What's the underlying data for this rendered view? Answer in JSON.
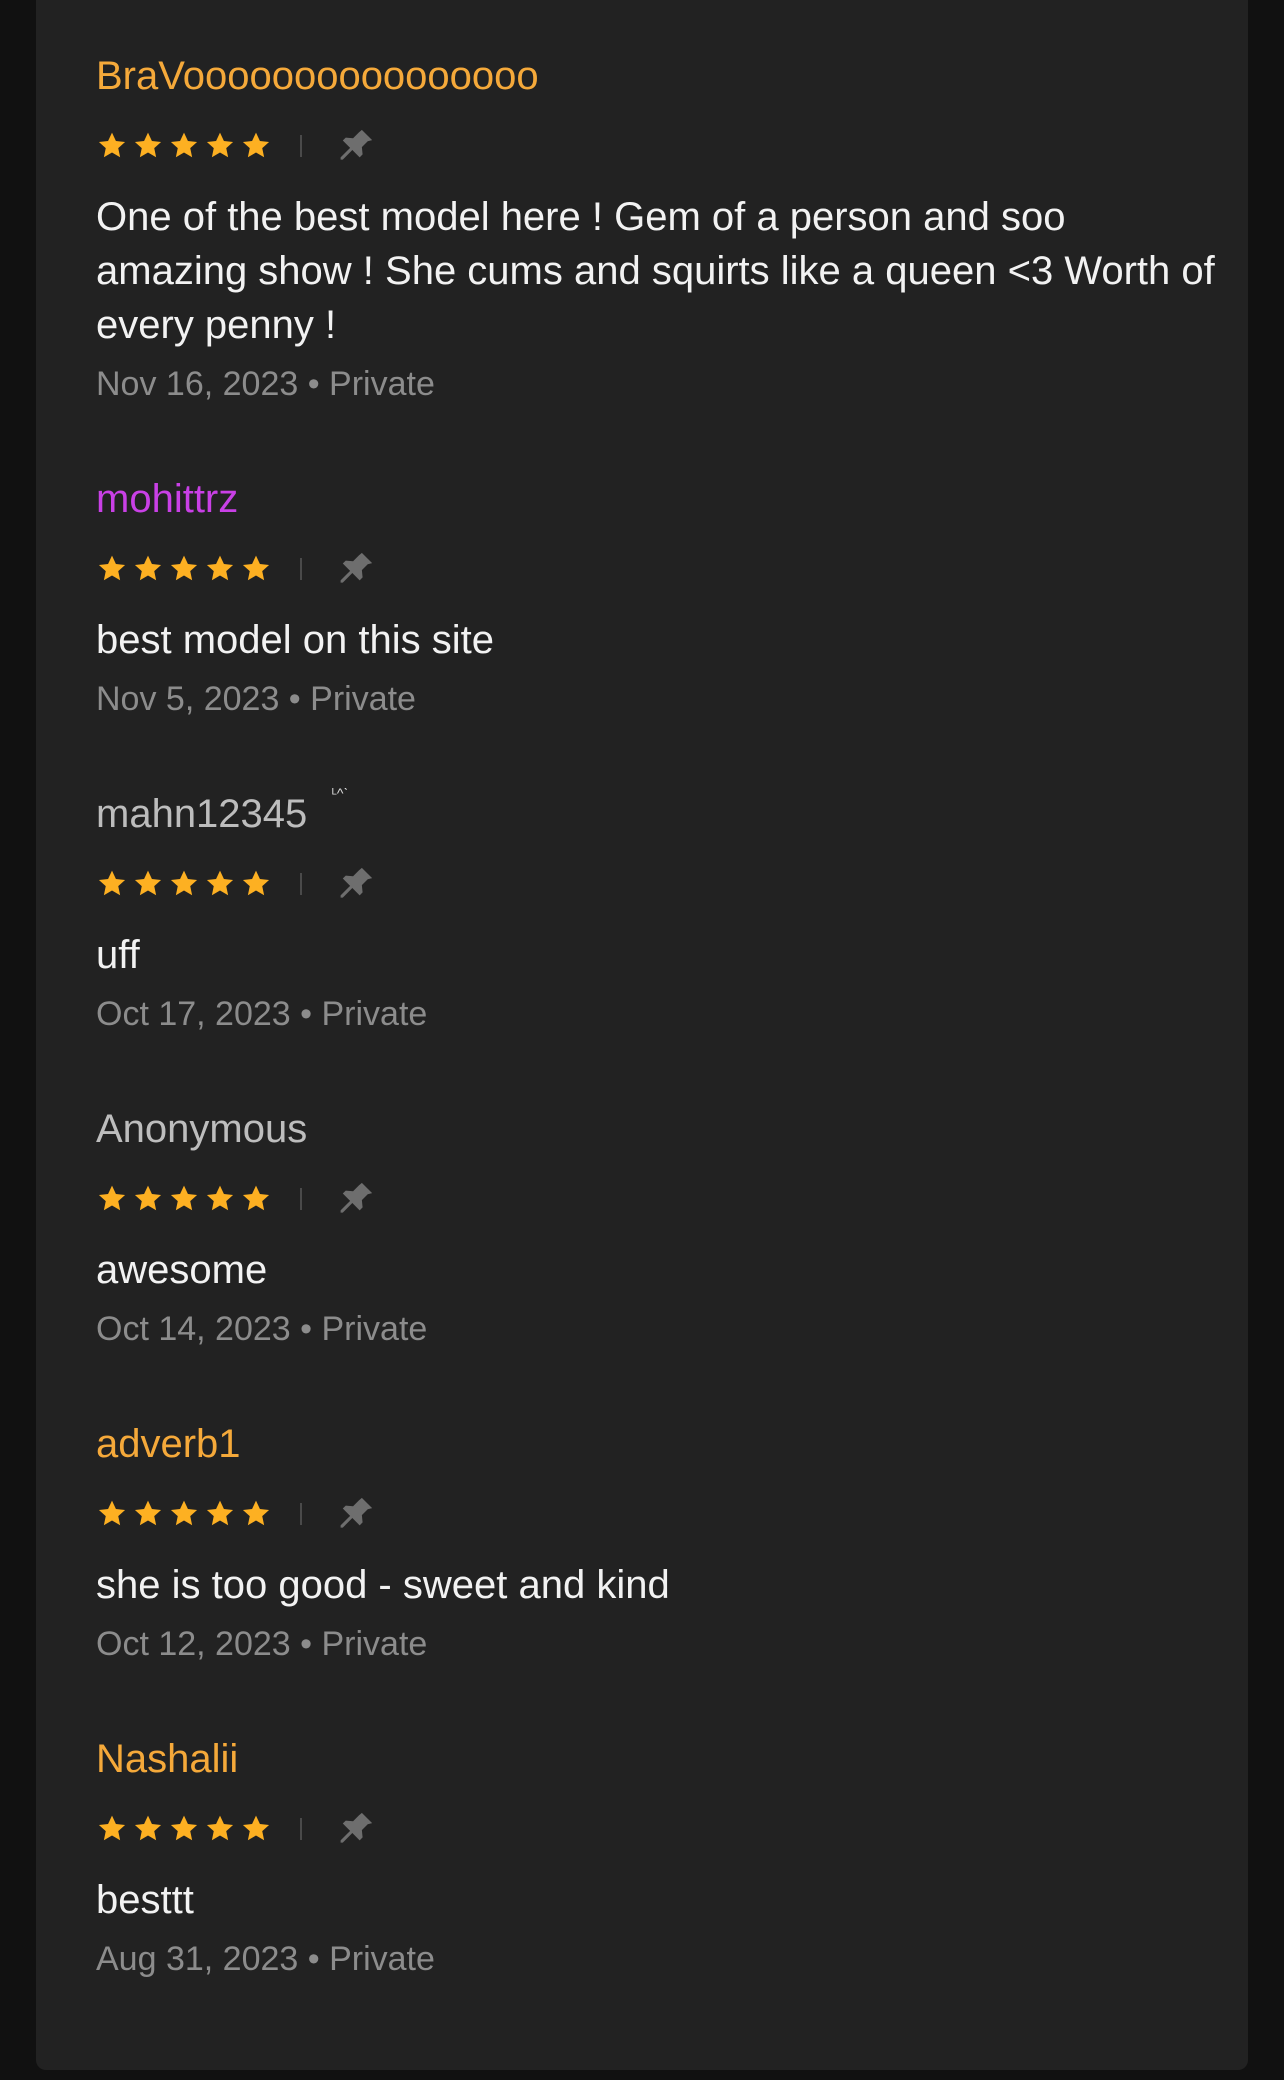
{
  "colors": {
    "star": "#fdb022",
    "pin": "#6e6e6e",
    "panel": "#222222",
    "name_gold": "#f5a93a",
    "name_purple": "#c940e6",
    "name_gray": "#bdbdbd"
  },
  "icons": {
    "star": "star-icon",
    "pin": "pin-icon"
  },
  "partial_top_text": "·",
  "reviews": [
    {
      "username": "BraVoooooooooooooooo",
      "name_color": "#f5a93a",
      "rating": 5,
      "text": "One of the best model here ! Gem of a person and soo amazing show ! She cums and squirts like a queen <3 Worth of every penny !",
      "meta": "Nov 16, 2023 • Private"
    },
    {
      "username": "mohittrz",
      "name_color": "#c940e6",
      "rating": 5,
      "text": "best model on this site",
      "meta": "Nov 5, 2023 • Private"
    },
    {
      "username": "mahn12345",
      "name_color": "#bdbdbd",
      "badge": "ᴸ^ˋ",
      "rating": 5,
      "text": "uff",
      "meta": "Oct 17, 2023 • Private"
    },
    {
      "username": "Anonymous",
      "name_color": "#bdbdbd",
      "rating": 5,
      "text": "awesome",
      "meta": "Oct 14, 2023 • Private"
    },
    {
      "username": "adverb1",
      "name_color": "#f5a93a",
      "rating": 5,
      "text": "she is too good - sweet and kind",
      "meta": "Oct 12, 2023 • Private"
    },
    {
      "username": "Nashalii",
      "name_color": "#f5a93a",
      "rating": 5,
      "text": "besttt",
      "meta": "Aug 31, 2023 • Private"
    }
  ]
}
